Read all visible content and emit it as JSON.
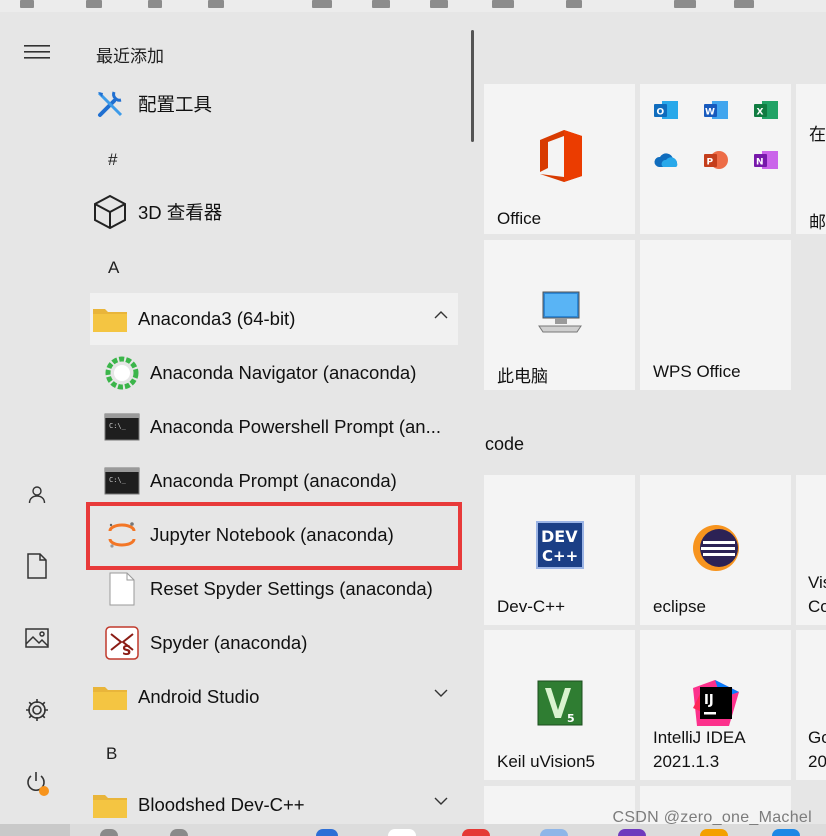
{
  "recent_header": "最近添加",
  "app_list": {
    "config_tool": "配置工具",
    "group_hash": "#",
    "viewer_3d": "3D 查看器",
    "group_a": "A",
    "anaconda_folder": "Anaconda3 (64-bit)",
    "anaconda_navigator": "Anaconda Navigator (anaconda)",
    "anaconda_powershell": "Anaconda Powershell Prompt (an...",
    "anaconda_prompt": "Anaconda Prompt (anaconda)",
    "jupyter": "Jupyter Notebook (anaconda)",
    "reset_spyder": "Reset Spyder Settings (anaconda)",
    "spyder": "Spyder (anaconda)",
    "android_studio": "Android Studio",
    "group_b": "B",
    "bloodshed": "Bloodshed Dev-C++"
  },
  "tiles": {
    "office": "Office",
    "partial_top": "在",
    "partial_mid": "邮",
    "this_pc": "此电脑",
    "wps": "WPS Office",
    "group_code": "code",
    "devcpp": "Dev-C++",
    "eclipse": "eclipse",
    "partial_vis1": "Vis",
    "partial_vis2": "Co",
    "keil": "Keil uVision5",
    "idea_l1": "IntelliJ IDEA",
    "idea_l2": "2021.1.3",
    "partial_go1": "Go",
    "partial_go2": "20"
  },
  "watermark": "CSDN @zero_one_Machel",
  "icons": {
    "rail": [
      "hamburger-icon",
      "user-icon",
      "document-icon",
      "pictures-icon",
      "settings-icon",
      "power-icon"
    ],
    "apps": [
      "tools-icon",
      "cube-icon",
      "folder-icon",
      "navigator-icon",
      "terminal-icon",
      "jupyter-icon",
      "file-icon",
      "spyder-icon"
    ],
    "tiles": [
      "office-icon",
      "outlook-icon",
      "word-icon",
      "excel-icon",
      "onedrive-icon",
      "powerpoint-icon",
      "onenote-icon",
      "monitor-icon",
      "devcpp-icon",
      "eclipse-icon",
      "keil-icon",
      "intellij-icon"
    ]
  },
  "colors": {
    "highlight": "#e83a3a",
    "folder": "#f4c542",
    "office_red": "#d83b01",
    "word": "#185abd",
    "excel": "#107c41",
    "outlook": "#0f6cbd",
    "onenote": "#7719aa",
    "power_notification": "#f7941d"
  }
}
